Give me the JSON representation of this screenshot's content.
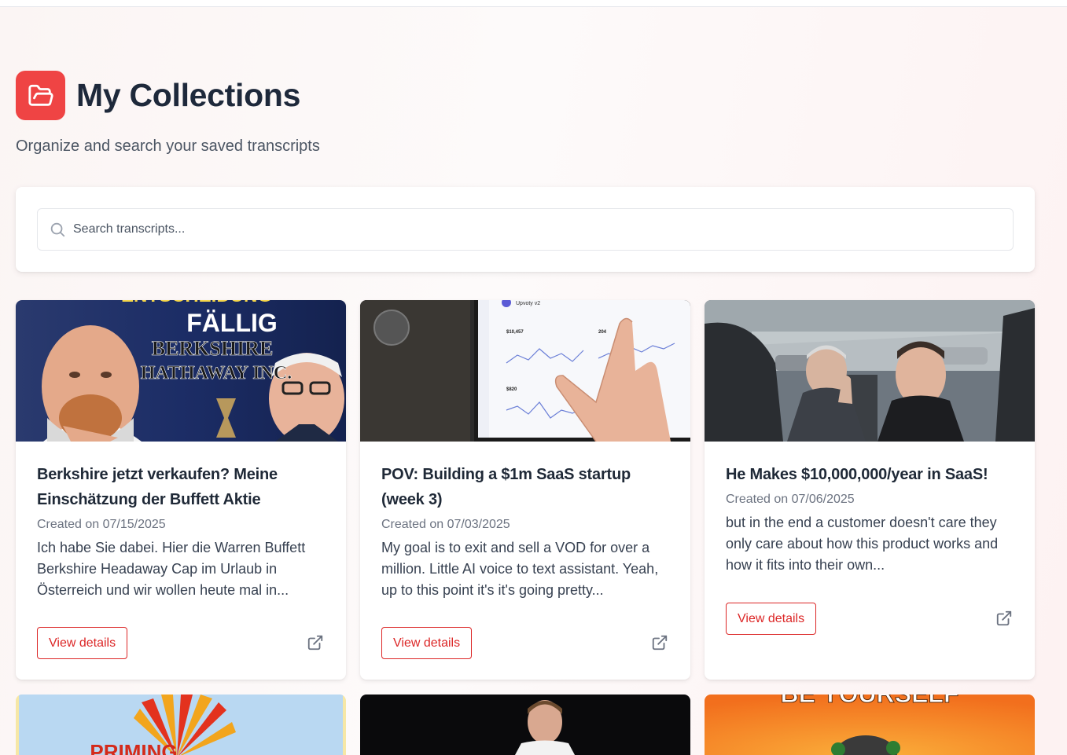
{
  "header": {
    "title": "My Collections",
    "subtitle": "Organize and search your saved transcripts",
    "icon": "folder-open-icon"
  },
  "search": {
    "placeholder": "Search transcripts...",
    "value": ""
  },
  "colors": {
    "accent": "#ef4444",
    "button_text": "#dc2626"
  },
  "cards": [
    {
      "title": "Berkshire jetzt verkaufen? Meine Einschätzung der Buffett Aktie",
      "date": "Created on 07/15/2025",
      "excerpt": "Ich habe Sie dabei. Hier die Warren Buffett Berkshire Headaway Cap im Urlaub in Österreich und wir wollen heute mal in...",
      "button": "View details",
      "thumb_text": {
        "top": "ENTSCHEIDUNG",
        "line1": "FÄLLIG",
        "line2": "BERKSHIRE",
        "line3": "HATHAWAY INC."
      }
    },
    {
      "title": "POV: Building a $1m SaaS startup (week 3)",
      "date": "Created on 07/03/2025",
      "excerpt": "My goal is to exit and sell a VOD for over a million. Little AI voice to text assistant. Yeah, up to this point it's it's going pretty...",
      "button": "View details",
      "thumb_text": {
        "app": "Upvoty v2",
        "metric1": "$10,457",
        "metric2": "204",
        "metric3": "$820"
      }
    },
    {
      "title": "He Makes $10,000,000/year in SaaS!",
      "date": "Created on 07/06/2025",
      "excerpt": "but in the end a customer doesn't care they only care about how this product works and how it fits into their own...",
      "button": "View details"
    }
  ],
  "row2_thumbs": [
    {
      "text": "PRIMING"
    },
    {
      "text": ""
    },
    {
      "text": "BE YOURSELF"
    }
  ]
}
